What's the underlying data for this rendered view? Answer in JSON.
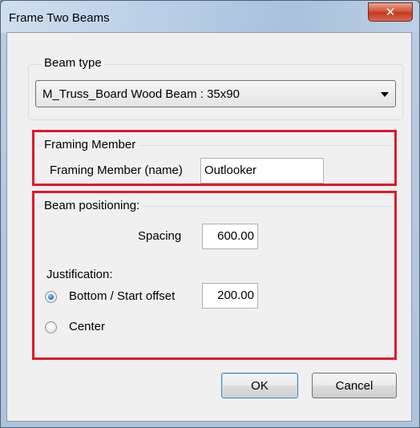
{
  "window": {
    "title": "Frame Two Beams",
    "close_glyph": "✕"
  },
  "beam_type": {
    "label": "Beam type",
    "selected": "M_Truss_Board Wood Beam : 35x90"
  },
  "framing_member": {
    "label": "Framing Member",
    "name_label": "Framing Member (name)",
    "name_value": "Outlooker"
  },
  "beam_positioning": {
    "label": "Beam positioning:",
    "spacing_label": "Spacing",
    "spacing_value": "600.00",
    "justification_label": "Justification:",
    "option_bottom_label": "Bottom / Start offset",
    "option_bottom_value": "200.00",
    "option_center_label": "Center",
    "selected_option": "bottom"
  },
  "buttons": {
    "ok": "OK",
    "cancel": "Cancel"
  },
  "colors": {
    "highlight": "#e0182b",
    "close_button": "#c23a22"
  }
}
